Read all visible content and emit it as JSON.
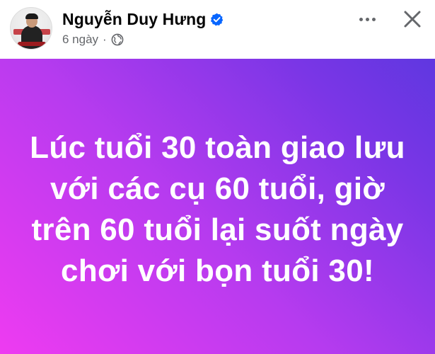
{
  "post": {
    "author_name": "Nguyễn Duy Hưng",
    "timestamp": "6 ngày",
    "separator": "·",
    "privacy_icon": "globe-icon",
    "verified_icon": "verified-badge-icon",
    "text": "Lúc tuổi 30 toàn giao lưu với các cụ 60 tuổi, giờ trên 60 tuổi lại suốt ngày chơi với bọn tuổi 30!"
  },
  "toolbar": {
    "more_icon": "more-options-icon",
    "close_icon": "close-icon"
  },
  "colors": {
    "verified_blue": "#0866ff",
    "meta_gray": "#65676b",
    "gradient_start": "#ee3bf1",
    "gradient_end": "#5f37e0"
  }
}
